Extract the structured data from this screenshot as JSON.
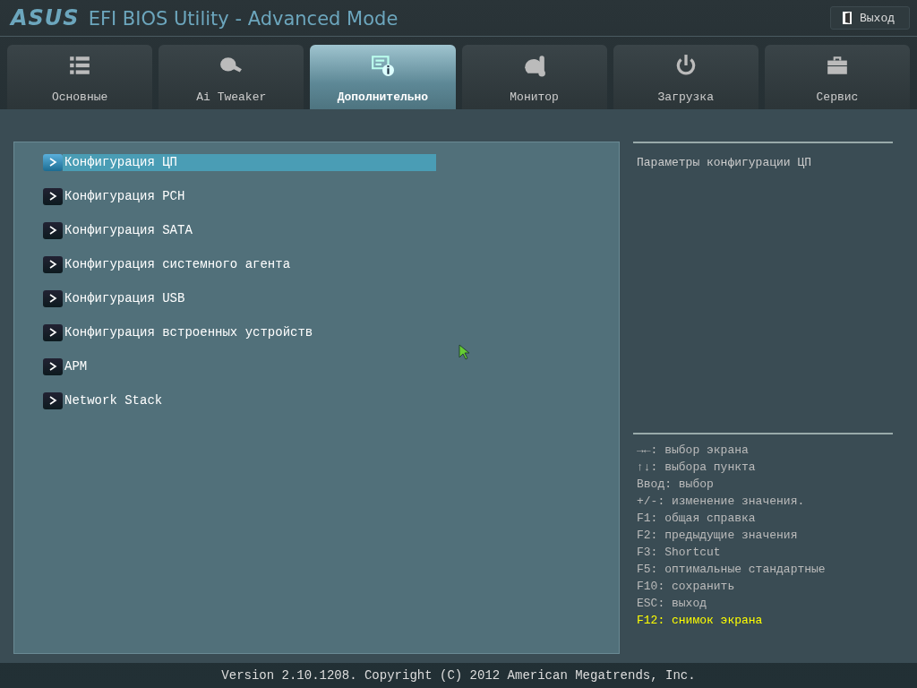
{
  "header": {
    "brand": "ASUS",
    "title": "EFI BIOS Utility - Advanced Mode",
    "exit_button": "Выход"
  },
  "tabs": [
    {
      "label": "Основные",
      "selected": false
    },
    {
      "label": "Ai Tweaker",
      "selected": false
    },
    {
      "label": "Дополнительно",
      "selected": true
    },
    {
      "label": "Монитор",
      "selected": false
    },
    {
      "label": "Загрузка",
      "selected": false
    },
    {
      "label": "Сервис",
      "selected": false
    }
  ],
  "menu_items": [
    {
      "label": "Конфигурация ЦП",
      "selected": true
    },
    {
      "label": "Конфигурация PCH",
      "selected": false
    },
    {
      "label": "Конфигурация SATA",
      "selected": false
    },
    {
      "label": "Конфигурация системного агента",
      "selected": false
    },
    {
      "label": "Конфигурация USB",
      "selected": false
    },
    {
      "label": "Конфигурация встроенных устройств",
      "selected": false
    },
    {
      "label": "APM",
      "selected": false
    },
    {
      "label": "Network Stack",
      "selected": false
    }
  ],
  "description": "Параметры конфигурации ЦП",
  "help_lines": [
    {
      "text": "→←: выбор экрана",
      "kind": "normal"
    },
    {
      "text": "↑↓: выбора пункта",
      "kind": "normal"
    },
    {
      "text": "Ввод: выбор",
      "kind": "normal"
    },
    {
      "text": "+/-: изменение значения.",
      "kind": "normal"
    },
    {
      "text": "F1: общая справка",
      "kind": "normal"
    },
    {
      "text": "F2: предыдущие значения",
      "kind": "normal"
    },
    {
      "text": "F3: Shortcut",
      "kind": "normal"
    },
    {
      "text": "F5: оптимальные стандартные",
      "kind": "normal"
    },
    {
      "text": "F10: сохранить",
      "kind": "normal"
    },
    {
      "text": "ESC: выход",
      "kind": "normal"
    },
    {
      "text": "F12: снимок экрана",
      "kind": "highlight"
    }
  ],
  "footer": "Version 2.10.1208. Copyright (C) 2012 American Megatrends, Inc."
}
